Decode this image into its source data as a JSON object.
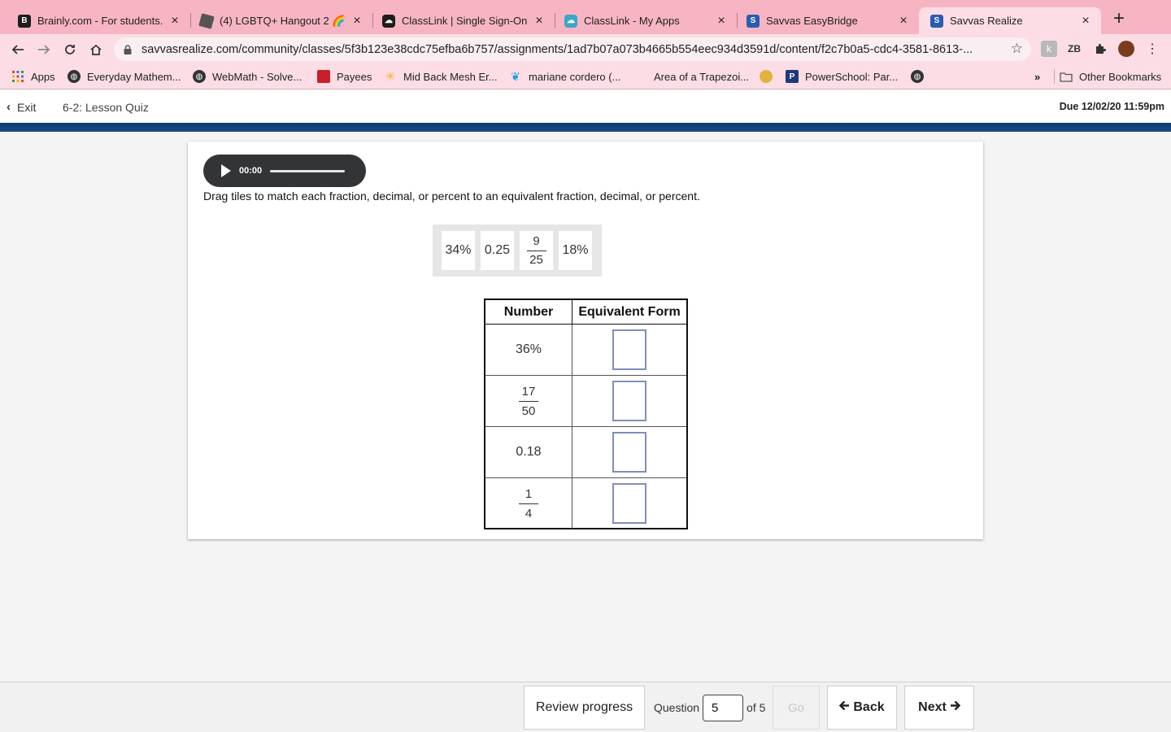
{
  "browser": {
    "tabs": [
      {
        "title": "Brainly.com - For students. B",
        "favicon": "brainly-icon",
        "active": false
      },
      {
        "title": "(4) LGBTQ+ Hangout 2 🌈 -",
        "favicon": "roblox-icon",
        "active": false
      },
      {
        "title": "ClassLink | Single Sign-On fo",
        "favicon": "classlink-icon",
        "active": false
      },
      {
        "title": "ClassLink - My Apps",
        "favicon": "classlink-apps-icon",
        "active": false
      },
      {
        "title": "Savvas EasyBridge",
        "favicon": "savvas-icon",
        "active": false
      },
      {
        "title": "Savvas Realize",
        "favicon": "savvas-icon",
        "active": true
      }
    ],
    "url": "savvasrealize.com/community/classes/5f3b123e38cdc75efba6b757/assignments/1ad7b07a073b4665b554eec934d3591d/content/f2c7b0a5-cdc4-3581-8613-...",
    "bookmarks": [
      {
        "label": "Apps",
        "icon": "apps-grid-icon"
      },
      {
        "label": "Everyday Mathem...",
        "icon": "globe-icon"
      },
      {
        "label": "WebMath - Solve...",
        "icon": "globe-icon"
      },
      {
        "label": "Payees",
        "icon": "payees-icon"
      },
      {
        "label": "Mid Back Mesh Er...",
        "icon": "walmart-icon"
      },
      {
        "label": "mariane cordero (...",
        "icon": "twitter-icon"
      },
      {
        "label": "Area of a Trapezoi...",
        "icon": ""
      },
      {
        "label": "",
        "icon": "emoji-icon"
      },
      {
        "label": "PowerSchool: Par...",
        "icon": "powerschool-icon"
      },
      {
        "label": "",
        "icon": "globe-icon"
      }
    ],
    "overflow": "»",
    "other_bookmarks": "Other Bookmarks"
  },
  "header": {
    "exit_label": "Exit",
    "quiz_title": "6-2: Lesson Quiz",
    "due": "Due 12/02/20 11:59pm"
  },
  "question": {
    "audio_time": "00:00",
    "prompt": "Drag tiles to match each fraction, decimal, or percent to an equivalent fraction, decimal, or percent.",
    "tiles": {
      "t1": "34%",
      "t2": "0.25",
      "t3_num": "9",
      "t3_den": "25",
      "t4": "18%"
    },
    "table": {
      "col1": "Number",
      "col2": "Equivalent Form",
      "r1": "36%",
      "r2_num": "17",
      "r2_den": "50",
      "r3": "0.18",
      "r4_num": "1",
      "r4_den": "4"
    }
  },
  "footer": {
    "review": "Review progress",
    "question_label": "Question",
    "question_value": "5",
    "of_label": "of 5",
    "go": "Go",
    "back": "Back",
    "next": "Next"
  },
  "colors": {
    "tab_strip": "#f7b5c3",
    "toolbar": "#fcdde5",
    "app_blue": "#0d3a6e",
    "drop_border": "#7f90b5"
  }
}
